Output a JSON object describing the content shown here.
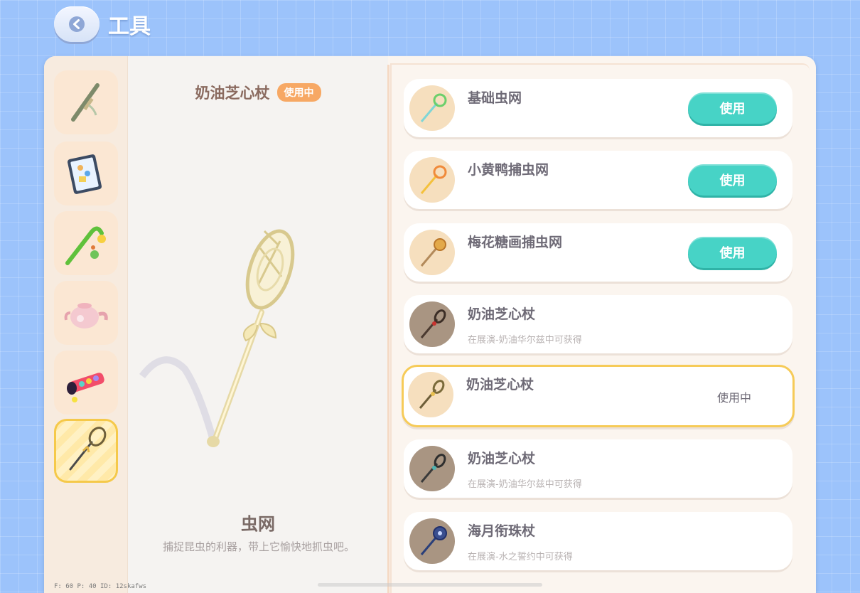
{
  "header": {
    "title": "工具"
  },
  "sidebar": {
    "items": [
      {
        "icon": "sword-tool-icon"
      },
      {
        "icon": "tablet-book-icon"
      },
      {
        "icon": "fishing-rod-icon"
      },
      {
        "icon": "teapot-icon"
      },
      {
        "icon": "kaleidoscope-icon"
      },
      {
        "icon": "bug-net-wand-icon",
        "active": true
      }
    ]
  },
  "preview": {
    "item_name": "奶油芝心杖",
    "status_badge": "使用中",
    "category_name": "虫网",
    "category_desc": "捕捉昆虫的利器，带上它愉快地抓虫吧。"
  },
  "list": {
    "items": [
      {
        "name": "基础虫网",
        "button": "使用",
        "thumb_color": "#7fd6d6"
      },
      {
        "name": "小黄鸭捕虫网",
        "button": "使用",
        "thumb_color": "#f4c13c"
      },
      {
        "name": "梅花糖画捕虫网",
        "button": "使用",
        "thumb_color": "#d89a3c"
      },
      {
        "name": "奶油芝心杖",
        "source": "在展演-奶油华尔兹中可获得",
        "thumb_color": "#8a6a54"
      },
      {
        "name": "奶油芝心杖",
        "status": "使用中",
        "thumb_color": "#e8d7a3"
      },
      {
        "name": "奶油芝心杖",
        "source": "在展演-奶油华尔兹中可获得",
        "thumb_color": "#6e8f8a"
      },
      {
        "name": "海月衔珠杖",
        "source": "在展演-水之誓约中可获得",
        "thumb_color": "#3a4f8f"
      }
    ]
  },
  "debug": {
    "text": "F: 60   P: 40   ID: 12skafws"
  },
  "colors": {
    "accent": "#47d3c6",
    "badge": "#f7a864",
    "selected_border": "#f6cb58"
  }
}
